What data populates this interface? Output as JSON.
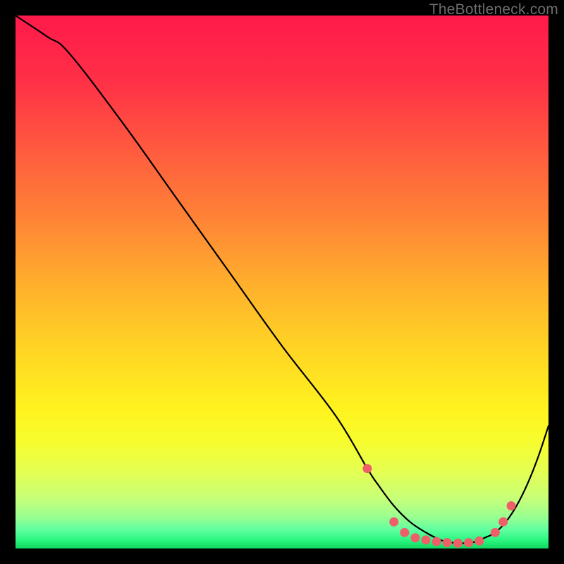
{
  "watermark": "TheBottleneck.com",
  "chart_data": {
    "type": "line",
    "title": "",
    "xlabel": "",
    "ylabel": "",
    "xlim": [
      0,
      100
    ],
    "ylim": [
      0,
      100
    ],
    "grid": false,
    "series": [
      {
        "name": "curve",
        "x": [
          0,
          6,
          10,
          20,
          30,
          40,
          50,
          60,
          66,
          68,
          71,
          74,
          77,
          80,
          83,
          86,
          88,
          90,
          92,
          94,
          96,
          98,
          100
        ],
        "y": [
          100,
          96,
          93,
          80,
          66,
          52,
          38,
          25,
          15,
          12,
          8,
          5,
          3,
          1.5,
          1,
          1.2,
          2,
          3,
          5,
          8,
          12,
          17,
          23
        ]
      }
    ],
    "markers": {
      "name": "points",
      "x": [
        66,
        71,
        73,
        75,
        77,
        79,
        81,
        83,
        85,
        87,
        90,
        91.5,
        93
      ],
      "y": [
        15,
        5,
        3,
        2,
        1.6,
        1.3,
        1.1,
        1.0,
        1.1,
        1.4,
        3,
        5,
        8
      ]
    },
    "gradient_stops": [
      {
        "offset": 0.0,
        "color": "#ff1a4b"
      },
      {
        "offset": 0.12,
        "color": "#ff2f47"
      },
      {
        "offset": 0.25,
        "color": "#ff5a3f"
      },
      {
        "offset": 0.38,
        "color": "#ff8336"
      },
      {
        "offset": 0.5,
        "color": "#ffae2d"
      },
      {
        "offset": 0.62,
        "color": "#ffd324"
      },
      {
        "offset": 0.74,
        "color": "#fff31f"
      },
      {
        "offset": 0.8,
        "color": "#f7fd2e"
      },
      {
        "offset": 0.86,
        "color": "#e2ff55"
      },
      {
        "offset": 0.905,
        "color": "#c8ff78"
      },
      {
        "offset": 0.94,
        "color": "#9bff90"
      },
      {
        "offset": 0.965,
        "color": "#5fffa0"
      },
      {
        "offset": 0.985,
        "color": "#29f57e"
      },
      {
        "offset": 1.0,
        "color": "#10d75f"
      }
    ],
    "marker_color": "#ef5f6a",
    "curve_color": "#000000"
  }
}
